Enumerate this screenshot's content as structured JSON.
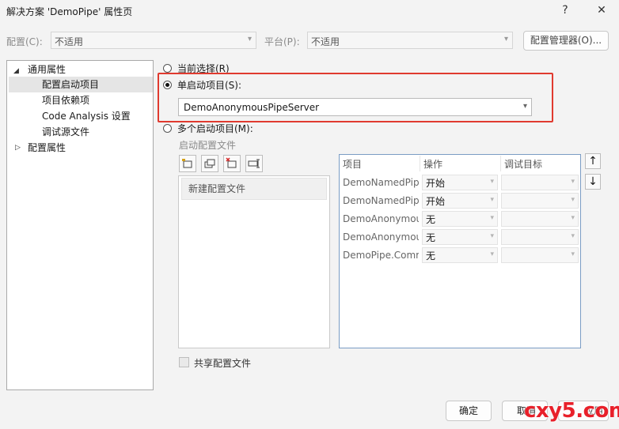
{
  "window": {
    "title": "解决方案 'DemoPipe' 属性页",
    "help": "?",
    "close": "✕"
  },
  "config": {
    "config_label": "配置(C):",
    "config_value": "不适用",
    "platform_label": "平台(P):",
    "platform_value": "不适用",
    "manager_button": "配置管理器(O)..."
  },
  "tree": {
    "common": "通用属性",
    "startup": "配置启动项目",
    "deps": "项目依赖项",
    "code_analysis": "Code Analysis 设置",
    "debug_source": "调试源文件",
    "config_props": "配置属性"
  },
  "startup": {
    "current_selection": "当前选择(R)",
    "single_label": "单启动项目(S):",
    "single_value": "DemoAnonymousPipeServer",
    "multiple_label": "多个启动项目(M):",
    "profile_label": "启动配置文件",
    "profile_item": "新建配置文件",
    "share_label": "共享配置文件"
  },
  "grid": {
    "headers": {
      "project": "项目",
      "action": "操作",
      "target": "调试目标"
    },
    "rows": [
      {
        "project": "DemoNamedPip",
        "action": "开始"
      },
      {
        "project": "DemoNamedPip",
        "action": "开始"
      },
      {
        "project": "DemoAnonymou",
        "action": "无"
      },
      {
        "project": "DemoAnonymou",
        "action": "无"
      },
      {
        "project": "DemoPipe.Comr",
        "action": "无"
      }
    ]
  },
  "footer": {
    "ok": "确定",
    "cancel": "取消",
    "apply": "应用",
    "brand": "cxy5.com"
  },
  "colors": {
    "highlight_border": "#e03a2f",
    "selected_bg": "#e5e5e5",
    "brand_text": "#e8202a"
  }
}
